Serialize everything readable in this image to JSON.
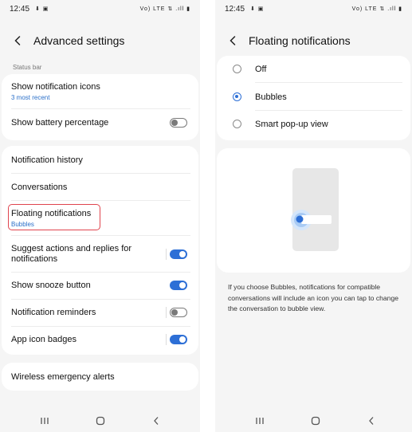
{
  "left": {
    "status": {
      "time": "12:45",
      "left_icons": "⬇ ▣",
      "right_icons": "Vo) LTE ⇅ .ıll ▮"
    },
    "title": "Advanced settings",
    "section_label": "Status bar",
    "status_bar_card": [
      {
        "label": "Show notification icons",
        "sub": "3 most recent"
      },
      {
        "label": "Show battery percentage",
        "toggle": "off"
      }
    ],
    "notification_card": [
      {
        "label": "Notification history"
      },
      {
        "label": "Conversations"
      },
      {
        "label": "Floating notifications",
        "sub": "Bubbles"
      },
      {
        "label_line1": "Suggest actions and replies for",
        "label_line2": "notifications",
        "toggle": "on"
      },
      {
        "label": "Show snooze button",
        "toggle": "on"
      },
      {
        "label": "Notification reminders",
        "toggle": "off"
      },
      {
        "label": "App icon badges",
        "toggle": "on"
      }
    ],
    "wea_card": {
      "label": "Wireless emergency alerts"
    }
  },
  "right": {
    "status": {
      "time": "12:45",
      "left_icons": "⬇ ▣",
      "right_icons": "Vo) LTE ⇅ .ıll ▮"
    },
    "title": "Floating notifications",
    "options": [
      {
        "label": "Off",
        "selected": false
      },
      {
        "label": "Bubbles",
        "selected": true
      },
      {
        "label": "Smart pop-up view",
        "selected": false
      }
    ],
    "description": "If you choose Bubbles, notifications for compatible conversations will include an icon you can tap to change the conversation to bubble view."
  },
  "colors": {
    "accent": "#2d6fd6",
    "highlight": "#e0444e",
    "background": "#f5f5f5",
    "card": "#ffffff"
  },
  "icons": [
    "back-arrow-icon",
    "recents-icon",
    "home-icon",
    "back-nav-icon"
  ]
}
